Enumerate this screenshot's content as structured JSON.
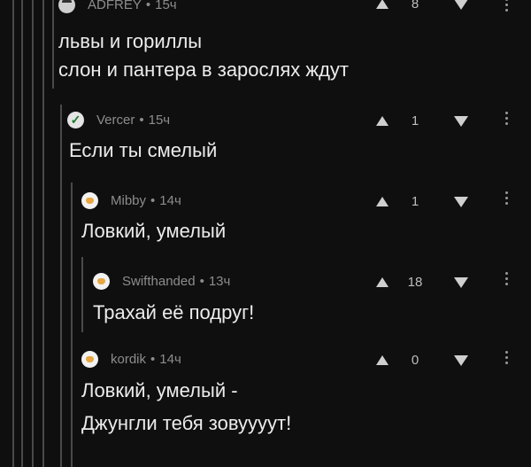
{
  "comments": [
    {
      "author": "ADFREY",
      "time": "15ч",
      "avatar": "user-avatar-icon",
      "lines": [
        "львы и гориллы",
        "слон и пантера в зарослях ждут"
      ],
      "score": "8"
    },
    {
      "author": "Vercer",
      "time": "15ч",
      "avatar": "check-avatar-icon",
      "lines": [
        "Если ты смелый"
      ],
      "score": "1"
    },
    {
      "author": "Mibby",
      "time": "14ч",
      "avatar": "bear-avatar-icon",
      "lines": [
        "Ловкий, умелый"
      ],
      "score": "1"
    },
    {
      "author": "Swifthanded",
      "time": "13ч",
      "avatar": "bear-avatar-icon",
      "lines": [
        "Трахай её подруг!"
      ],
      "score": "18"
    },
    {
      "author": "kordik",
      "time": "14ч",
      "avatar": "bear-avatar-icon",
      "lines": [
        "Ловкий, умелый -",
        "Джунгли тебя зовуууут!"
      ],
      "score": "0"
    }
  ],
  "separator": "•"
}
